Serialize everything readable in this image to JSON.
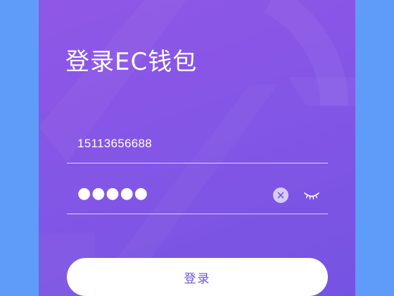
{
  "login": {
    "title": "登录EC钱包",
    "phone_value": "15113656688",
    "password_mask": "●●●●●",
    "submit_label": "登录"
  },
  "icons": {
    "clear": "clear-circle-icon",
    "visibility": "eye-closed-icon"
  },
  "colors": {
    "page_background": "#5f9bf8",
    "panel_gradient_start": "#9057e6",
    "panel_gradient_end": "#7553e2",
    "button_text": "#6d54df"
  }
}
